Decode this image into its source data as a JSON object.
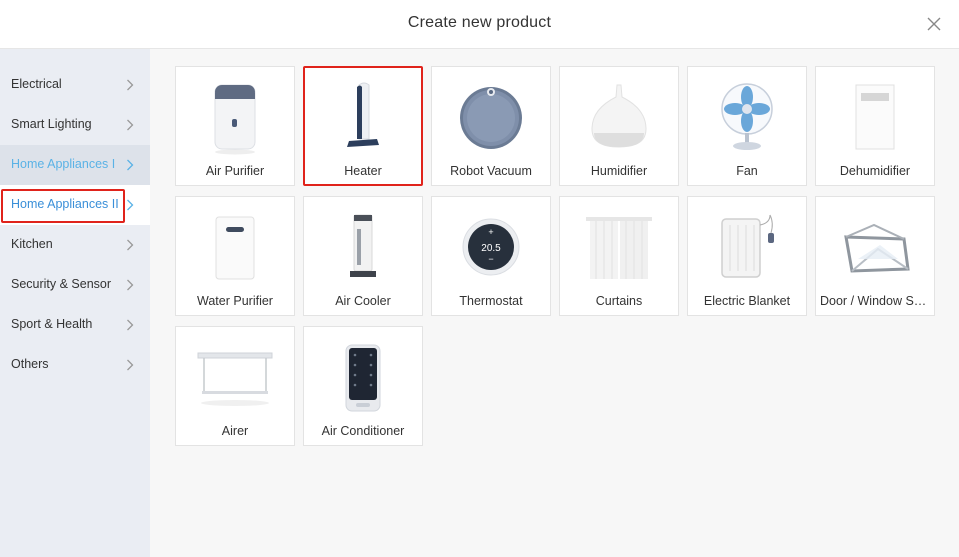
{
  "dialog": {
    "title": "Create new product",
    "close_icon": "close-icon"
  },
  "sidebar": {
    "items": [
      {
        "label": "Electrical",
        "state": "normal"
      },
      {
        "label": "Smart Lighting",
        "state": "normal"
      },
      {
        "label": "Home Appliances I",
        "state": "hover"
      },
      {
        "label": "Home Appliances II",
        "state": "active"
      },
      {
        "label": "Kitchen",
        "state": "normal"
      },
      {
        "label": "Security & Sensor",
        "state": "normal"
      },
      {
        "label": "Sport & Health",
        "state": "normal"
      },
      {
        "label": "Others",
        "state": "normal"
      }
    ]
  },
  "products": [
    {
      "name": "Air Purifier",
      "icon": "air-purifier-icon"
    },
    {
      "name": "Heater",
      "icon": "heater-icon",
      "selected": true
    },
    {
      "name": "Robot Vacuum",
      "icon": "robot-vacuum-icon"
    },
    {
      "name": "Humidifier",
      "icon": "humidifier-icon"
    },
    {
      "name": "Fan",
      "icon": "fan-icon"
    },
    {
      "name": "Dehumidifier",
      "icon": "dehumidifier-icon"
    },
    {
      "name": "Water Purifier",
      "icon": "water-purifier-icon"
    },
    {
      "name": "Air Cooler",
      "icon": "air-cooler-icon"
    },
    {
      "name": "Thermostat",
      "icon": "thermostat-icon",
      "display": "20.5"
    },
    {
      "name": "Curtains",
      "icon": "curtains-icon"
    },
    {
      "name": "Electric Blanket",
      "icon": "electric-blanket-icon"
    },
    {
      "name": "Door / Window Sensor",
      "icon": "door-window-icon"
    },
    {
      "name": "Airer",
      "icon": "airer-icon"
    },
    {
      "name": "Air Conditioner",
      "icon": "air-conditioner-icon"
    }
  ],
  "colors": {
    "accent": "#3a8fd8",
    "highlight": "#e0231b",
    "sidebar_bg": "#eaedf3",
    "content_bg": "#f7f7f7"
  }
}
